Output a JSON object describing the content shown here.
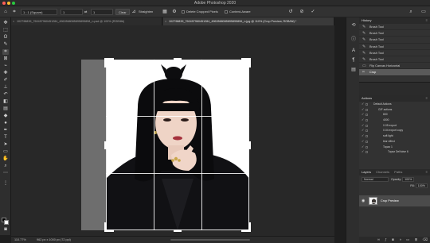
{
  "app": {
    "title": "Adobe Photoshop 2020"
  },
  "options_bar": {
    "ratio": "1 : 1 (Square)",
    "width": "1",
    "height": "1",
    "clear": "Clear",
    "straighten": "Straighten",
    "delete_cropped": "Delete Cropped Pixels",
    "content_aware": "Content-Aware"
  },
  "tabs": [
    {
      "label": "102798839_760497960451284_4962868085895895898_n.psd @ 100% (RGB/8#)"
    },
    {
      "label": "102798839_760497960451284_4962868085895895896_n.jpg @ 110% (Crop Preview, RGB/8#) *"
    }
  ],
  "status": {
    "zoom": "110.77%",
    "doc": "962 px x 1000 px (72 ppi)"
  },
  "history": {
    "title": "History",
    "items": [
      "Brush Tool",
      "Brush Tool",
      "Brush Tool",
      "Brush Tool",
      "Brush Tool",
      "Brush Tool",
      "Flip Canvas Horizontal",
      "Crop"
    ]
  },
  "actions": {
    "title": "Actions",
    "items": [
      {
        "label": "Default Actions",
        "level": 0
      },
      {
        "label": "GIF actions",
        "level": 1
      },
      {
        "label": "800",
        "level": 2
      },
      {
        "label": "4000",
        "level": 2
      },
      {
        "label": "0.05 export",
        "level": 2
      },
      {
        "label": "0.04 export copy",
        "level": 2
      },
      {
        "label": "soft light",
        "level": 2
      },
      {
        "label": "blur effect",
        "level": 2
      },
      {
        "label": "Topaz 1",
        "level": 2
      },
      {
        "label": "Topaz DeNoise 6",
        "level": 3
      }
    ]
  },
  "layers": {
    "tabs": [
      "Layers",
      "Channels",
      "Paths"
    ],
    "blend_mode": "Normal",
    "opacity_label": "Opacity:",
    "opacity": "100%",
    "fill_label": "Fill:",
    "fill": "100%",
    "layer_name": "Crop Preview"
  },
  "colors": {
    "accent": "#4a8bd6",
    "canvas_bg": "#282828",
    "panel_bg": "#323232"
  }
}
